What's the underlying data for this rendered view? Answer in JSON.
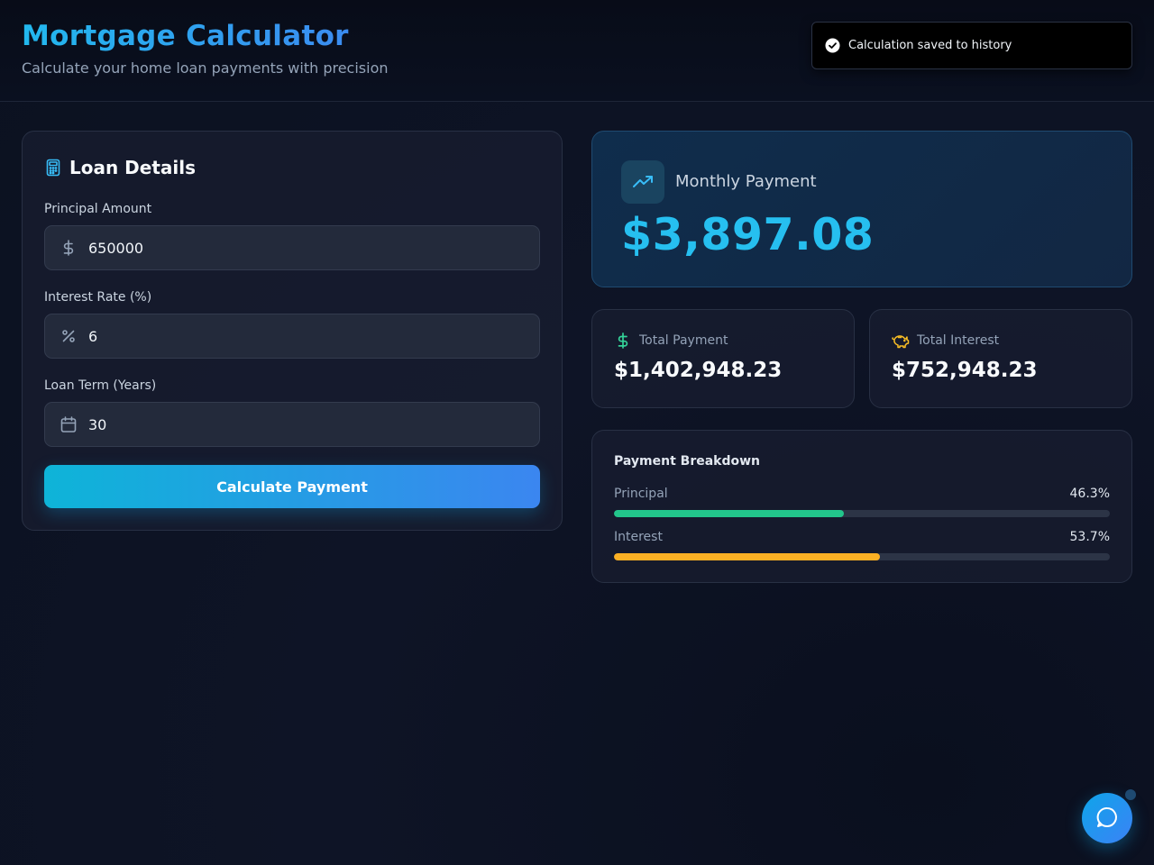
{
  "header": {
    "title": "Mortgage Calculator",
    "subtitle": "Calculate your home loan payments with precision"
  },
  "toast": {
    "icon": "check-circle-icon",
    "message": "Calculation saved to history"
  },
  "loan_details": {
    "title": "Loan Details",
    "icon": "calculator-icon",
    "fields": [
      {
        "label": "Principal Amount",
        "value": "650000",
        "icon": "dollar-icon"
      },
      {
        "label": "Interest Rate (%)",
        "value": "6",
        "icon": "percent-icon"
      },
      {
        "label": "Loan Term (Years)",
        "value": "30",
        "icon": "calendar-icon"
      }
    ],
    "button_label": "Calculate Payment"
  },
  "results": {
    "monthly": {
      "label": "Monthly Payment",
      "value": "$3,897.08",
      "icon": "trending-up-icon"
    },
    "total_payment": {
      "label": "Total Payment",
      "value": "$1,402,948.23",
      "icon": "dollar-icon"
    },
    "total_interest": {
      "label": "Total Interest",
      "value": "$752,948.23",
      "icon": "piggy-bank-icon"
    }
  },
  "breakdown": {
    "title": "Payment Breakdown",
    "rows": [
      {
        "label": "Principal",
        "percent_label": "46.3%",
        "fraction": 0.463,
        "color": "#22c58b"
      },
      {
        "label": "Interest",
        "percent_label": "53.7%",
        "fraction": 0.537,
        "color": "#fbb024"
      }
    ]
  },
  "colors": {
    "accent": "#26bff0",
    "accent_blue": "#3b86f0",
    "principal": "#22c58b",
    "interest": "#fbb024"
  },
  "chat": {
    "icon": "chat-bubble-icon"
  }
}
